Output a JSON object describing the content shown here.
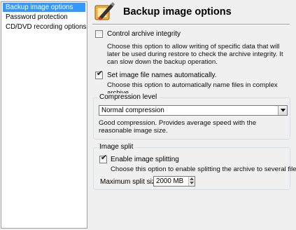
{
  "sidebar": {
    "items": [
      {
        "label": "Backup image options",
        "selected": true
      },
      {
        "label": "Password protection",
        "selected": false
      },
      {
        "label": "CD/DVD recording options",
        "selected": false
      }
    ]
  },
  "header": {
    "title": "Backup image options",
    "icon": "edit-brush-icon"
  },
  "options": {
    "control_integrity": {
      "label": "Control archive integrity",
      "checked": false,
      "description": "Choose this option to allow writing of specific data that will later be used during restore to check the archive integrity. It can slow down the backup operation."
    },
    "auto_names": {
      "label": "Set image file names automatically.",
      "checked": true,
      "description": "Choose this option to automatically name files in complex archive."
    }
  },
  "compression": {
    "group_title": "Compression level",
    "selected": "Normal compression",
    "description": "Good compression. Provides average speed with the reasonable image size."
  },
  "split": {
    "group_title": "Image split",
    "enable_label": "Enable image splitting",
    "enabled": true,
    "description": "Choose this option to enable splitting the archive to several files",
    "max_size_label": "Maximum split size:",
    "max_size_value": "2000 MB"
  }
}
